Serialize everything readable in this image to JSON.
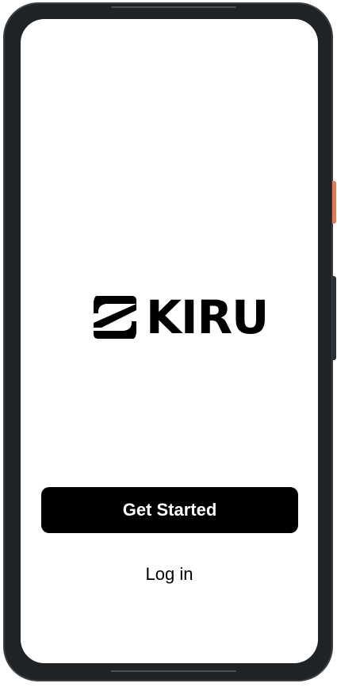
{
  "app": {
    "brand_name": "KIRU",
    "logo_icon": "kiru-logo-icon"
  },
  "actions": {
    "get_started_label": "Get Started",
    "login_label": "Log in"
  },
  "colors": {
    "device_frame": "#1f2326",
    "power_button_accent": "#e07a52",
    "primary_button_bg": "#000000",
    "primary_button_text": "#ffffff",
    "screen_bg": "#ffffff"
  }
}
